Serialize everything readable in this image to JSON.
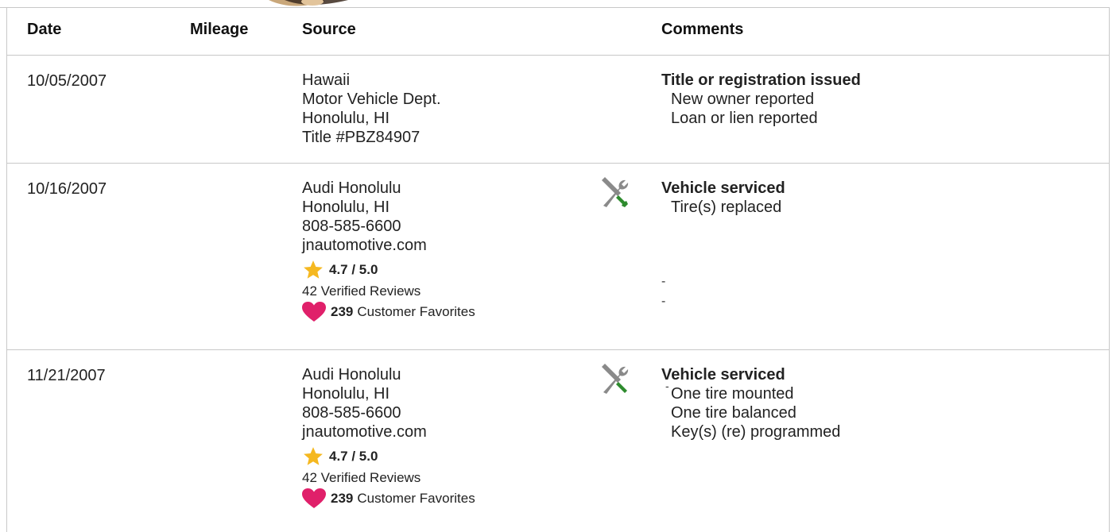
{
  "header": {
    "date": "Date",
    "mileage": "Mileage",
    "source": "Source",
    "comments": "Comments"
  },
  "rows": [
    {
      "date": "10/05/2007",
      "mileage": "",
      "source": [
        "Hawaii",
        "Motor Vehicle Dept.",
        "Honolulu, HI",
        "Title #PBZ84907"
      ],
      "comment_title": "Title or registration issued",
      "comment_items": [
        "New owner reported",
        "Loan or lien reported"
      ]
    },
    {
      "date": "10/16/2007",
      "mileage": "",
      "source": [
        "Audi Honolulu",
        "Honolulu, HI",
        "808-585-6600",
        "jnautomotive.com"
      ],
      "rating": "4.7 / 5.0",
      "reviews": "42 Verified Reviews",
      "favorites_count": "239",
      "favorites_label": "Customer Favorites",
      "service_icon": "wrench-screwdriver-icon",
      "comment_title": "Vehicle serviced",
      "comment_items": [
        "Tire(s) replaced"
      ],
      "dashes": [
        "-",
        "-"
      ]
    },
    {
      "date": "11/21/2007",
      "mileage": "",
      "source": [
        "Audi Honolulu",
        "Honolulu, HI",
        "808-585-6600",
        "jnautomotive.com"
      ],
      "rating": "4.7 / 5.0",
      "reviews": "42 Verified Reviews",
      "favorites_count": "239",
      "favorites_label": "Customer Favorites",
      "service_icon": "wrench-screwdriver-icon",
      "comment_title": "Vehicle serviced",
      "comment_items": [
        "One tire mounted",
        "One tire balanced",
        "Key(s) (re) programmed"
      ],
      "dashes": [
        "-"
      ]
    }
  ],
  "colors": {
    "star": "#F5B820",
    "heart": "#E0206A",
    "wrench": "#8A8A8A",
    "screwdriver_handle": "#2E8B2E",
    "border": "#C8C8C8"
  }
}
